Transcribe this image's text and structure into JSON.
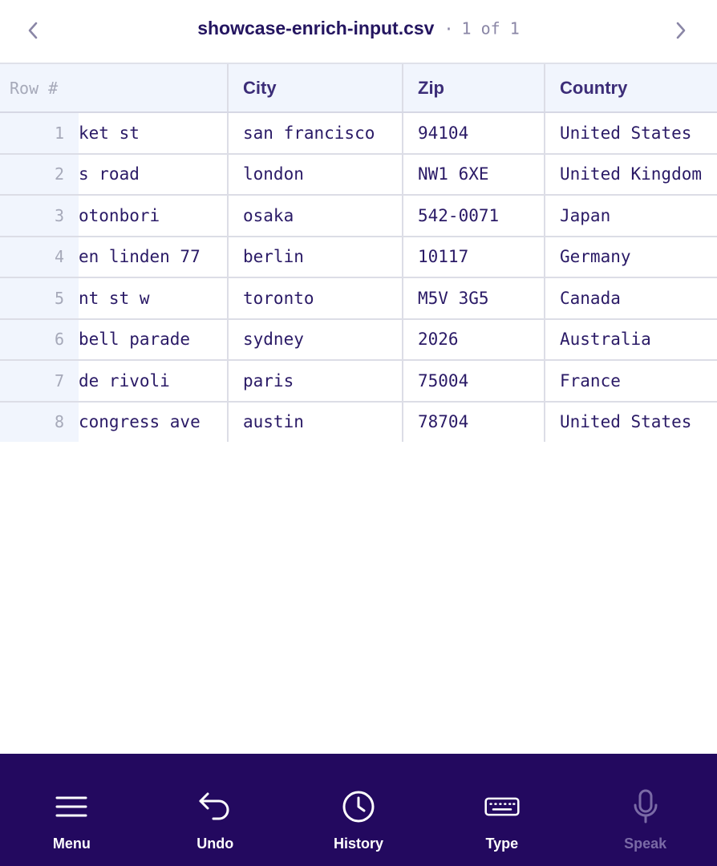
{
  "header": {
    "file_title": "showcase-enrich-input.csv",
    "separator": "·",
    "page_count": "1 of 1"
  },
  "table": {
    "columns": [
      "Row #",
      "City",
      "Zip",
      "Country"
    ],
    "rows": [
      {
        "num": "1",
        "address": "ket st",
        "city": "san francisco",
        "zip": "94104",
        "country": "United States"
      },
      {
        "num": "2",
        "address": "s road",
        "city": "london",
        "zip": "NW1 6XE",
        "country": "United Kingdom"
      },
      {
        "num": "3",
        "address": "otonbori",
        "city": "osaka",
        "zip": "542-0071",
        "country": "Japan"
      },
      {
        "num": "4",
        "address": "en linden 77",
        "city": "berlin",
        "zip": "10117",
        "country": "Germany"
      },
      {
        "num": "5",
        "address": "nt st w",
        "city": "toronto",
        "zip": "M5V 3G5",
        "country": "Canada"
      },
      {
        "num": "6",
        "address": "bell parade",
        "city": "sydney",
        "zip": "2026",
        "country": "Australia"
      },
      {
        "num": "7",
        "address": "de rivoli",
        "city": "paris",
        "zip": "75004",
        "country": "France"
      },
      {
        "num": "8",
        "address": "congress ave",
        "city": "austin",
        "zip": "78704",
        "country": "United States"
      }
    ]
  },
  "toolbar": {
    "items": [
      {
        "label": "Menu",
        "icon": "menu-icon"
      },
      {
        "label": "Undo",
        "icon": "undo-icon"
      },
      {
        "label": "History",
        "icon": "clock-icon"
      },
      {
        "label": "Type",
        "icon": "keyboard-icon"
      },
      {
        "label": "Speak",
        "icon": "microphone-icon",
        "disabled": true
      }
    ]
  },
  "colors": {
    "toolbar_bg": "#23095f",
    "header_cell_bg": "#f1f5fd",
    "text_primary": "#2a1a66",
    "muted": "#a6a9b9"
  }
}
